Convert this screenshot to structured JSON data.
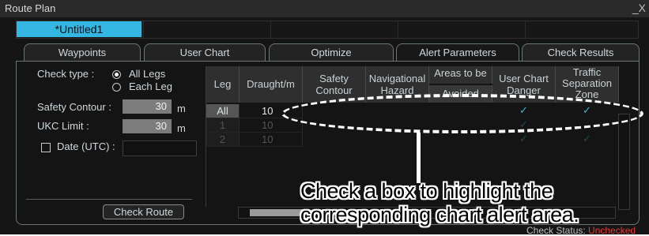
{
  "window": {
    "title": "Route Plan",
    "close_glyph": "_X"
  },
  "document_tab": "*Untitled1",
  "tabs": [
    "Waypoints",
    "User Chart",
    "Optimize",
    "Alert Parameters",
    "Check Results"
  ],
  "active_tab": "Alert Parameters",
  "form": {
    "check_type_label": "Check type :",
    "option_all_legs": "All Legs",
    "option_each_leg": "Each Leg",
    "selected_option": "All Legs",
    "safety_contour_label": "Safety Contour :",
    "safety_contour_value": "30",
    "safety_contour_unit": "m",
    "ukc_limit_label": "UKC Limit :",
    "ukc_limit_value": "30",
    "ukc_limit_unit": "m",
    "date_label": "Date (UTC) :",
    "check_route_button": "Check Route"
  },
  "table": {
    "headers": {
      "leg": "Leg",
      "draught": "Draught/m",
      "safety_contour": "Safety Contour",
      "navigational_hazard": "Navigational Hazard",
      "areas_to_be": "Areas to be",
      "avoided": "Avoided",
      "user_chart_danger": "User Chart Danger",
      "traffic_separation_zone": "Traffic Separation Zone"
    },
    "rows": [
      {
        "leg": "All",
        "draught": "10",
        "user_chart_danger": true,
        "traffic_separation_zone": true
      },
      {
        "leg": "1",
        "draught": "10",
        "user_chart_danger": true,
        "traffic_separation_zone": false
      },
      {
        "leg": "2",
        "draught": "10",
        "user_chart_danger": true,
        "traffic_separation_zone": true
      }
    ],
    "check_glyph": "✓"
  },
  "status": {
    "label": "Check Status:",
    "value": "Unchecked"
  },
  "annotation": {
    "line1": "Check a box to highlight the",
    "line2": "corresponding chart alert area."
  },
  "colors": {
    "accent": "#35b7e3",
    "check": "#38b7e6",
    "status_bad": "#e53935"
  }
}
